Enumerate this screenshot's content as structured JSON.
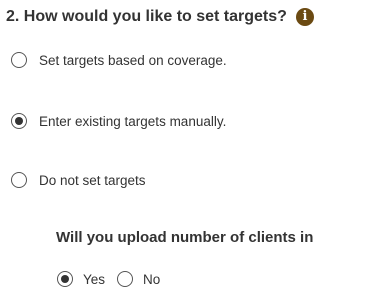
{
  "question": {
    "title": "2. How would you like to set targets?",
    "info_icon": "info-icon"
  },
  "options": [
    {
      "label": "Set targets based on coverage.",
      "selected": false
    },
    {
      "label": "Enter existing targets manually.",
      "selected": true
    },
    {
      "label": "Do not set targets",
      "selected": false
    }
  ],
  "sub_question": {
    "title": "Will you upload number of clients in",
    "options": [
      {
        "label": "Yes",
        "selected": true
      },
      {
        "label": "No",
        "selected": false
      }
    ]
  }
}
